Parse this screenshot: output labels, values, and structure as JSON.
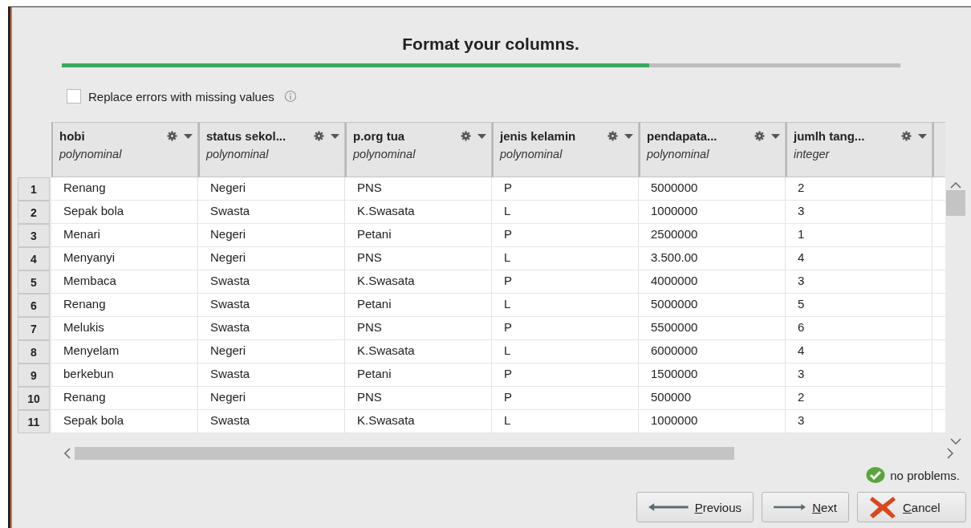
{
  "title": "Format your columns.",
  "progress": {
    "level": 0.7
  },
  "replace_errors": {
    "label": "Replace errors with missing values",
    "checked": false
  },
  "table": {
    "columns": [
      {
        "name": "hobi",
        "type": "polynominal"
      },
      {
        "name": "status sekol...",
        "type": "polynominal"
      },
      {
        "name": "p.org tua",
        "type": "polynominal"
      },
      {
        "name": "jenis kelamin",
        "type": "polynominal"
      },
      {
        "name": "pendapata...",
        "type": "polynominal"
      },
      {
        "name": "jumlh tang...",
        "type": "integer"
      }
    ],
    "rows": [
      {
        "number": "1",
        "cells": [
          "Renang",
          "Negeri",
          "PNS",
          "P",
          "5000000",
          "2"
        ]
      },
      {
        "number": "2",
        "cells": [
          "Sepak bola",
          "Swasta",
          "K.Swasata",
          "L",
          "1000000",
          "3"
        ]
      },
      {
        "number": "3",
        "cells": [
          "Menari",
          "Negeri",
          "Petani",
          "P",
          "2500000",
          "1"
        ]
      },
      {
        "number": "4",
        "cells": [
          "Menyanyi",
          "Negeri",
          "PNS",
          "L",
          "3.500.00",
          "4"
        ]
      },
      {
        "number": "5",
        "cells": [
          "Membaca",
          "Swasta",
          "K.Swasata",
          "P",
          "4000000",
          "3"
        ]
      },
      {
        "number": "6",
        "cells": [
          "Renang",
          "Swasta",
          "Petani",
          "L",
          "5000000",
          "5"
        ]
      },
      {
        "number": "7",
        "cells": [
          "Melukis",
          "Swasta",
          "PNS",
          "P",
          "5500000",
          "6"
        ]
      },
      {
        "number": "8",
        "cells": [
          "Menyelam",
          "Negeri",
          "K.Swasata",
          "L",
          "6000000",
          "4"
        ]
      },
      {
        "number": "9",
        "cells": [
          "berkebun",
          "Swasta",
          "Petani",
          "P",
          "1500000",
          "3"
        ]
      },
      {
        "number": "10",
        "cells": [
          "Renang",
          "Negeri",
          "PNS",
          "P",
          "500000",
          "2"
        ]
      },
      {
        "number": "11",
        "cells": [
          "Sepak bola",
          "Swasta",
          "K.Swasata",
          "L",
          "1000000",
          "3"
        ]
      }
    ]
  },
  "status": "no problems.",
  "buttons": [
    {
      "kind": "previous",
      "label": "Previous"
    },
    {
      "kind": "next",
      "label": "Next"
    },
    {
      "kind": "cancel",
      "label": "Cancel"
    }
  ]
}
